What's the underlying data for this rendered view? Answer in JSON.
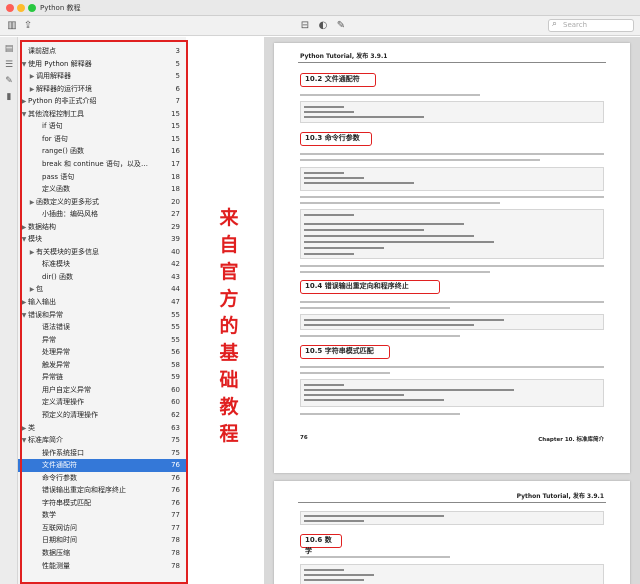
{
  "window": {
    "title": "Python 教程"
  },
  "search": {
    "placeholder": "Search"
  },
  "annotation": [
    "来",
    "自",
    "官",
    "方",
    "的",
    "基",
    "础",
    "教",
    "程"
  ],
  "outline": [
    {
      "label": "课前甜点",
      "page": "3",
      "level": 0,
      "expander": "none"
    },
    {
      "label": "使用 Python 解释器",
      "page": "5",
      "level": 0,
      "expander": "open"
    },
    {
      "label": "调用解释器",
      "page": "5",
      "level": 1,
      "expander": "closed"
    },
    {
      "label": "解释器的运行环境",
      "page": "6",
      "level": 1,
      "expander": "closed"
    },
    {
      "label": "Python 的非正式介绍",
      "page": "7",
      "level": 0,
      "expander": "closed"
    },
    {
      "label": "其他流程控制工具",
      "page": "15",
      "level": 0,
      "expander": "open"
    },
    {
      "label": "if 语句",
      "page": "15",
      "level": 2,
      "expander": "none"
    },
    {
      "label": "for 语句",
      "page": "15",
      "level": 2,
      "expander": "none"
    },
    {
      "label": "range() 函数",
      "page": "16",
      "level": 2,
      "expander": "none"
    },
    {
      "label": "break 和 continue 语句，以及循环中的 el...",
      "page": "17",
      "level": 2,
      "expander": "none"
    },
    {
      "label": "pass 语句",
      "page": "18",
      "level": 2,
      "expander": "none"
    },
    {
      "label": "定义函数",
      "page": "18",
      "level": 2,
      "expander": "none"
    },
    {
      "label": "函数定义的更多形式",
      "page": "20",
      "level": 1,
      "expander": "closed"
    },
    {
      "label": "小插曲：编码风格",
      "page": "27",
      "level": 2,
      "expander": "none"
    },
    {
      "label": "数据结构",
      "page": "29",
      "level": 0,
      "expander": "closed"
    },
    {
      "label": "模块",
      "page": "39",
      "level": 0,
      "expander": "open"
    },
    {
      "label": "有关模块的更多信息",
      "page": "40",
      "level": 1,
      "expander": "closed"
    },
    {
      "label": "标准模块",
      "page": "42",
      "level": 2,
      "expander": "none"
    },
    {
      "label": "dir() 函数",
      "page": "43",
      "level": 2,
      "expander": "none"
    },
    {
      "label": "包",
      "page": "44",
      "level": 1,
      "expander": "closed"
    },
    {
      "label": "输入输出",
      "page": "47",
      "level": 0,
      "expander": "closed"
    },
    {
      "label": "错误和异常",
      "page": "55",
      "level": 0,
      "expander": "open"
    },
    {
      "label": "语法错误",
      "page": "55",
      "level": 2,
      "expander": "none"
    },
    {
      "label": "异常",
      "page": "55",
      "level": 2,
      "expander": "none"
    },
    {
      "label": "处理异常",
      "page": "56",
      "level": 2,
      "expander": "none"
    },
    {
      "label": "触发异常",
      "page": "58",
      "level": 2,
      "expander": "none"
    },
    {
      "label": "异常链",
      "page": "59",
      "level": 2,
      "expander": "none"
    },
    {
      "label": "用户自定义异常",
      "page": "60",
      "level": 2,
      "expander": "none"
    },
    {
      "label": "定义清理操作",
      "page": "60",
      "level": 2,
      "expander": "none"
    },
    {
      "label": "预定义的清理操作",
      "page": "62",
      "level": 2,
      "expander": "none"
    },
    {
      "label": "类",
      "page": "63",
      "level": 0,
      "expander": "closed"
    },
    {
      "label": "标准库简介",
      "page": "75",
      "level": 0,
      "expander": "open"
    },
    {
      "label": "操作系统接口",
      "page": "75",
      "level": 2,
      "expander": "none"
    },
    {
      "label": "文件通配符",
      "page": "76",
      "level": 2,
      "expander": "none",
      "selected": true
    },
    {
      "label": "命令行参数",
      "page": "76",
      "level": 2,
      "expander": "none"
    },
    {
      "label": "错误输出重定向和程序终止",
      "page": "76",
      "level": 2,
      "expander": "none"
    },
    {
      "label": "字符串模式匹配",
      "page": "76",
      "level": 2,
      "expander": "none"
    },
    {
      "label": "数学",
      "page": "77",
      "level": 2,
      "expander": "none"
    },
    {
      "label": "互联网访问",
      "page": "77",
      "level": 2,
      "expander": "none"
    },
    {
      "label": "日期和时间",
      "page": "78",
      "level": 2,
      "expander": "none"
    },
    {
      "label": "数据压缩",
      "page": "78",
      "level": 2,
      "expander": "none"
    },
    {
      "label": "性能测量",
      "page": "78",
      "level": 2,
      "expander": "none"
    }
  ],
  "page1": {
    "header": "Python Tutorial, 发布 3.9.1",
    "sections": [
      "10.2 文件通配符",
      "10.3 命令行参数",
      "10.4 错误输出重定向和程序终止",
      "10.5 字符串模式匹配"
    ],
    "footer_page": "76",
    "footer_chapter": "Chapter 10. 标准库简介"
  },
  "page2": {
    "header": "Python Tutorial, 发布 3.9.1",
    "sections": [
      "10.6 数学"
    ]
  },
  "colors": {
    "accent": "#3478d8",
    "annotation": "#e01f1f"
  }
}
